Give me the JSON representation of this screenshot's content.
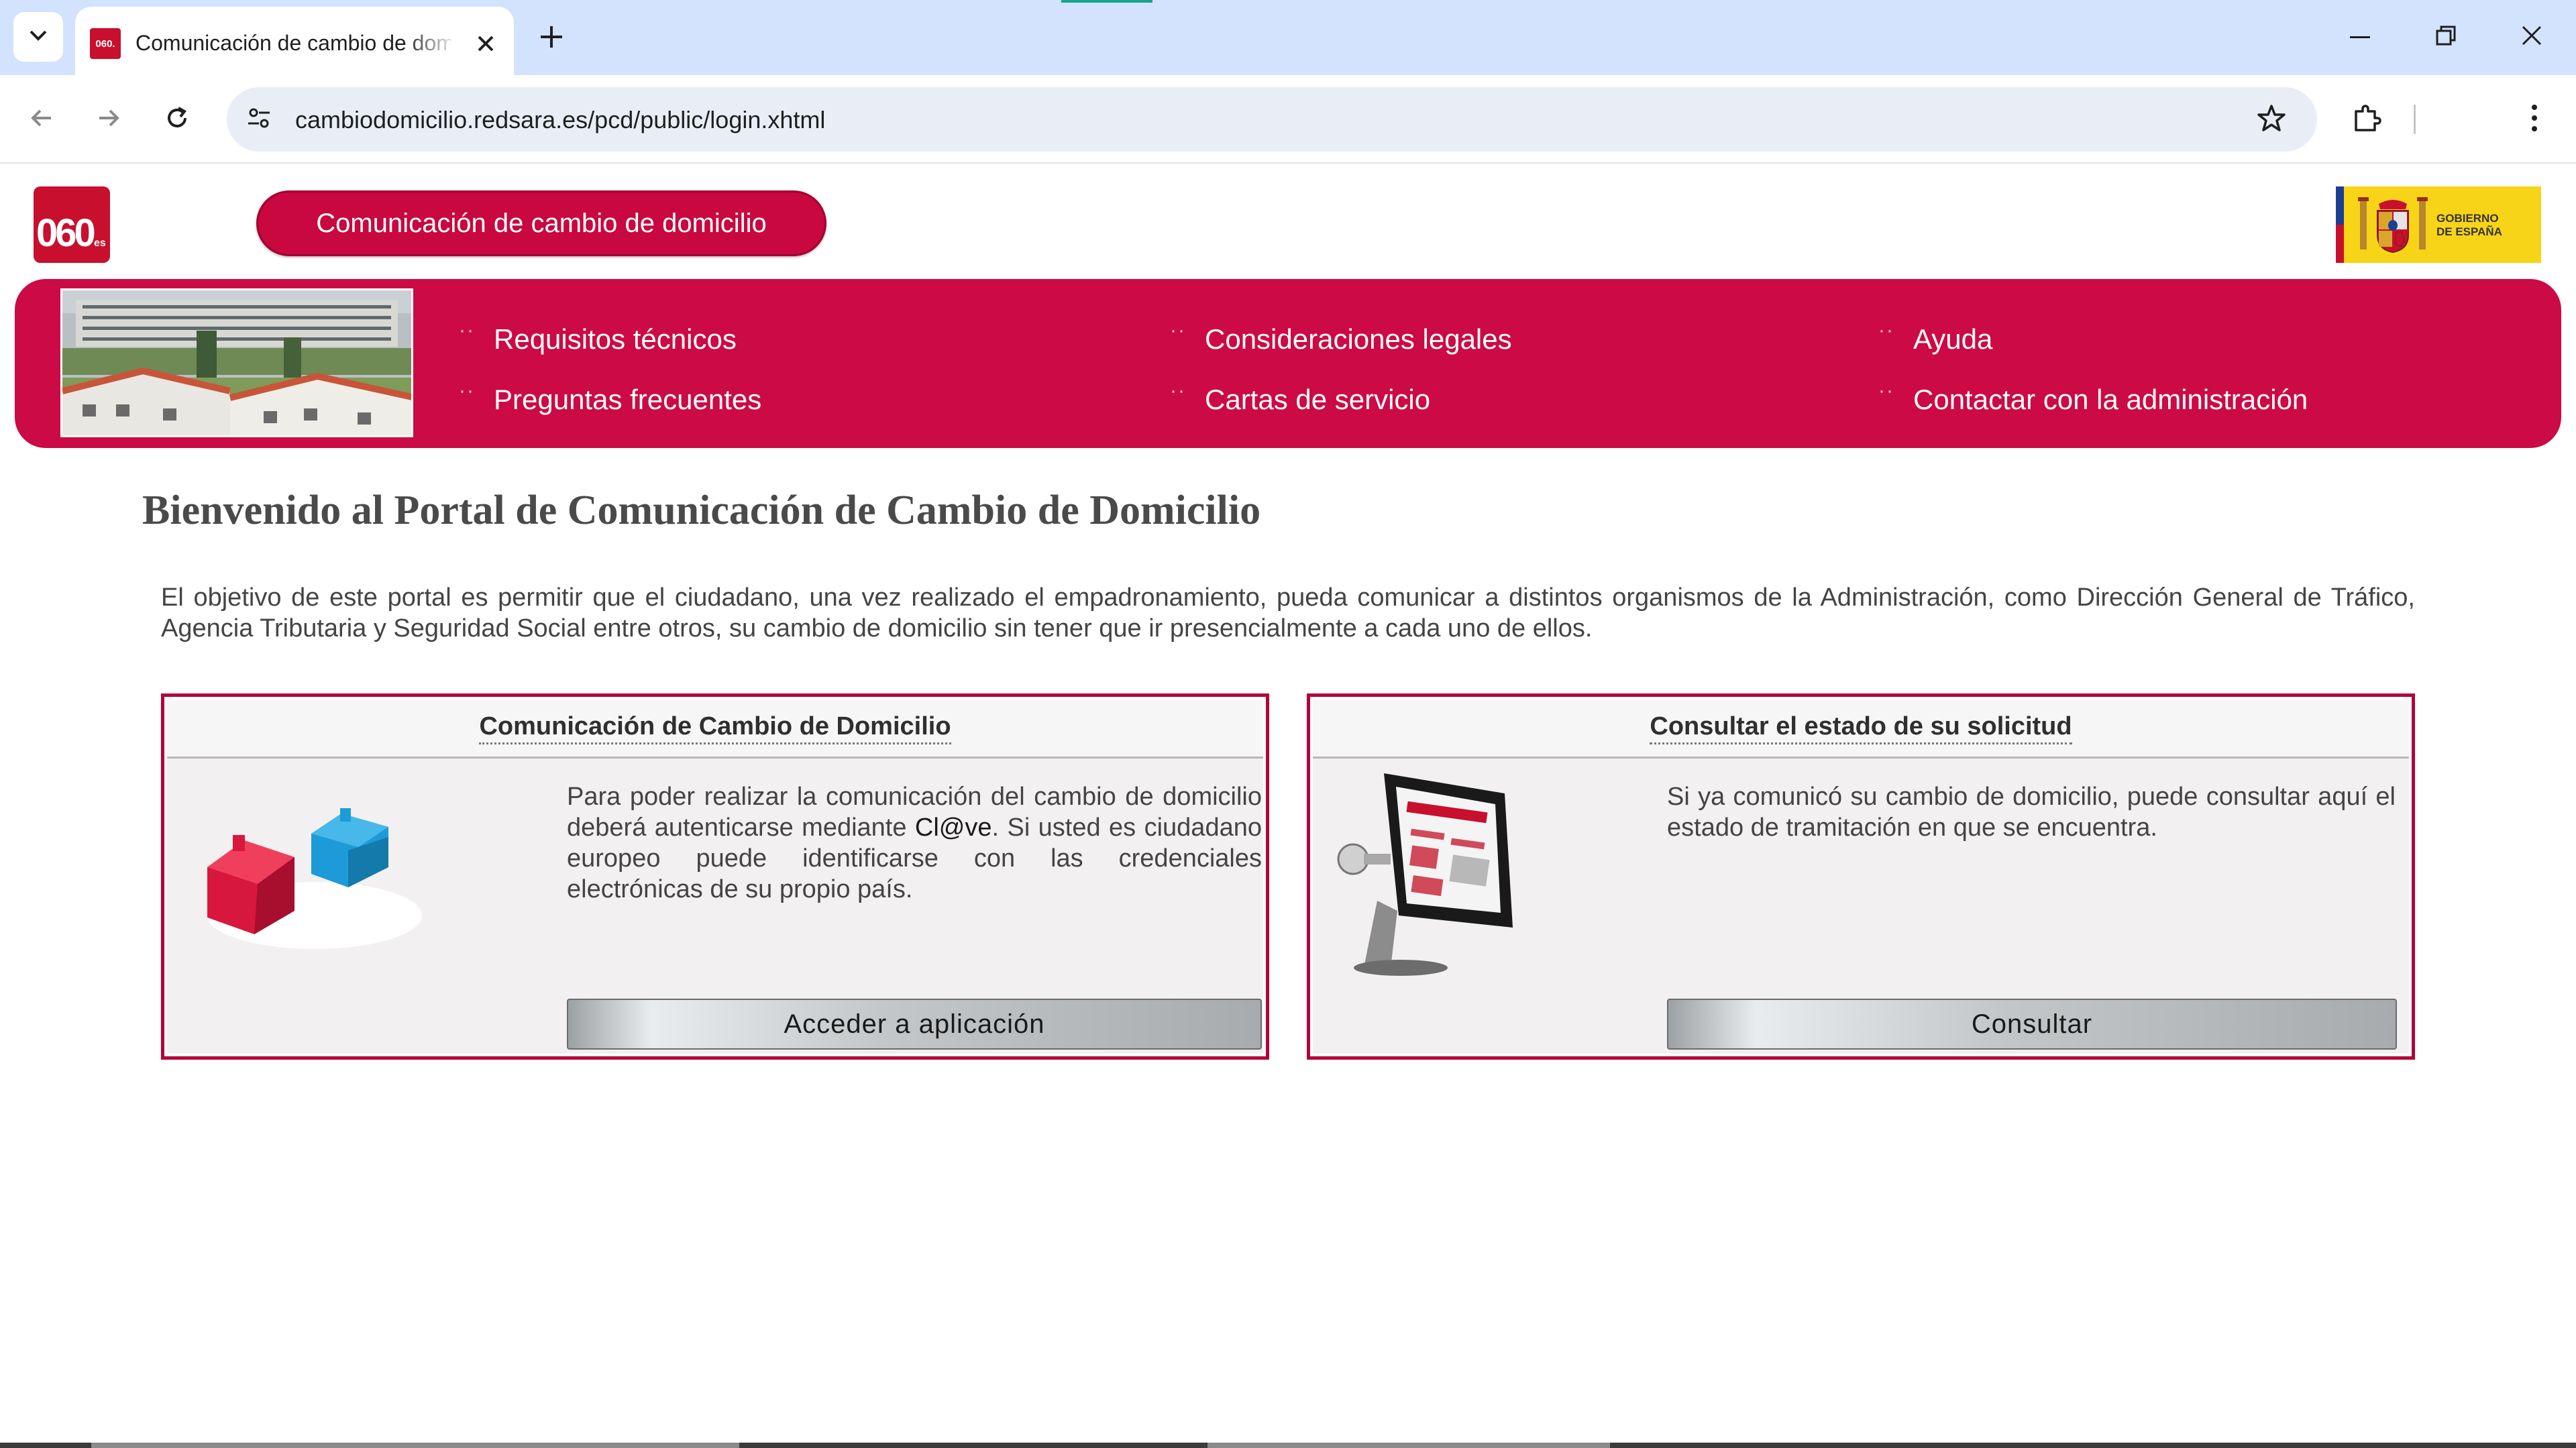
{
  "browser": {
    "tab_title": "Comunicación de cambio de domicilio",
    "tab_favicon": "060.",
    "url": "cambiodomicilio.redsara.es/pcd/public/login.xhtml",
    "icons": [
      "tab-search-icon",
      "close-icon",
      "new-tab-icon",
      "minimize-icon",
      "restore-icon",
      "window-close-icon",
      "back-icon",
      "forward-icon",
      "reload-icon",
      "site-info-icon",
      "bookmark-star-icon",
      "extensions-icon",
      "menu-dots-icon"
    ]
  },
  "header": {
    "logo_text": "060",
    "logo_suffix": "es",
    "title": "Comunicación de cambio de domicilio",
    "gov_logo_line1": "GOBIERNO",
    "gov_logo_line2": "DE ESPAÑA"
  },
  "nav": {
    "links": [
      "Requisitos técnicos",
      "Consideraciones legales",
      "Ayuda",
      "Preguntas frecuentes",
      "Cartas de servicio",
      "Contactar con la administración"
    ]
  },
  "main": {
    "welcome_title": "Bienvenido al Portal de Comunicación de Cambio de Domicilio",
    "intro": "El objetivo de este portal es permitir que el ciudadano, una vez realizado el empadronamiento, pueda comunicar a distintos organismos de la Administración, como Dirección General de Tráfico, Agencia Tributaria y Seguridad Social entre otros, su cambio de domicilio sin tener que ir presencialmente a cada uno de ellos."
  },
  "cards": {
    "left": {
      "title": "Comunicación de Cambio de Domicilio",
      "text_before": "Para poder realizar la comunicación del cambio de domicilio deberá autenticarse mediante ",
      "clave": "Cl@ve",
      "text_after": ". Si usted es ciudadano europeo puede identificarse con las credenciales electrónicas de su propio país.",
      "button": "Acceder a aplicación"
    },
    "right": {
      "title": "Consultar el estado de su solicitud",
      "text": "Si ya comunicó su cambio de domicilio, puede consultar aquí el estado de tramitación en que se encuentra.",
      "button": "Consultar"
    }
  },
  "colors": {
    "brand": "#c8083f",
    "card_border": "#b3003a",
    "chrome_tabstrip": "#d3e3fd"
  }
}
